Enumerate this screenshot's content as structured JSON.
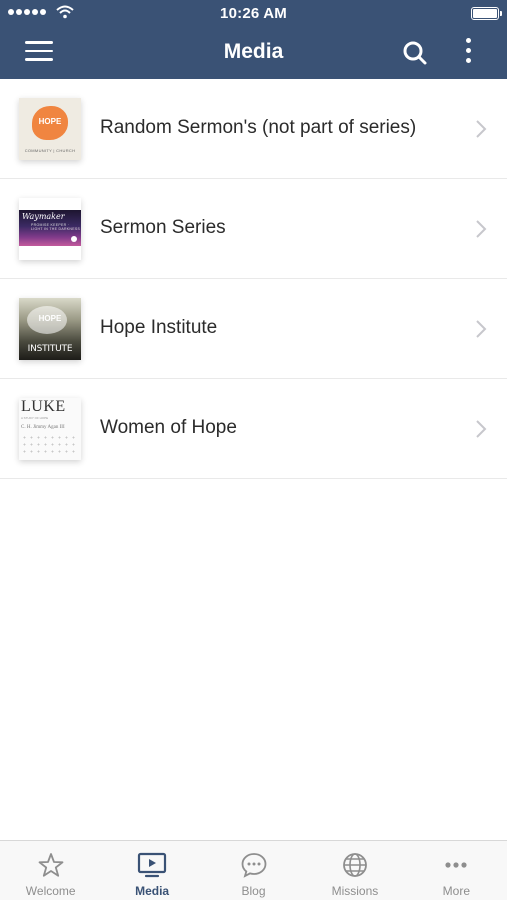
{
  "status_bar": {
    "time": "10:26 AM"
  },
  "header": {
    "title": "Media"
  },
  "media_items": [
    {
      "label": "Random Sermon's (not part of series)",
      "thumb_text": [
        "HOPE",
        "COMMUNITY | CHURCH"
      ]
    },
    {
      "label": "Sermon Series",
      "thumb_text": [
        "Waymaker",
        "PROMISE KEEPER · LIGHT IN THE DARKNESS"
      ]
    },
    {
      "label": "Hope Institute",
      "thumb_text": [
        "HOPE",
        "INSTITUTE"
      ]
    },
    {
      "label": "Women of Hope",
      "thumb_text": [
        "LUKE",
        "A STUDY OF HOPE",
        "C. H. Jimmy Agan III"
      ]
    }
  ],
  "tabs": [
    {
      "label": "Welcome",
      "icon": "star-icon",
      "active": false
    },
    {
      "label": "Media",
      "icon": "play-screen-icon",
      "active": true
    },
    {
      "label": "Blog",
      "icon": "chat-bubble-icon",
      "active": false
    },
    {
      "label": "Missions",
      "icon": "globe-icon",
      "active": false
    },
    {
      "label": "More",
      "icon": "ellipsis-icon",
      "active": false
    }
  ],
  "colors": {
    "header_bg": "#3a5275",
    "active_tab": "#3a5275",
    "inactive_tab": "#8e8e8e"
  }
}
